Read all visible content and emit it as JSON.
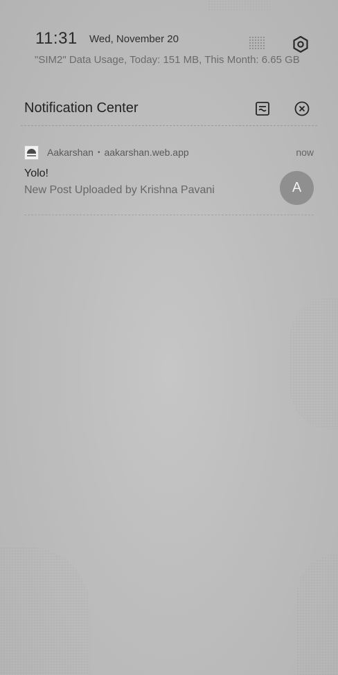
{
  "status": {
    "time": "11:31",
    "date": "Wed, November 20",
    "data_usage": "\"SIM2\" Data Usage, Today: 151 MB, This Month: 6.65 GB",
    "icons": [
      "dotted-grid-icon",
      "settings-gear-icon"
    ]
  },
  "notification_center": {
    "title": "Notification Center",
    "manage_icon": "manage-notifications-icon",
    "clear_icon": "clear-all-icon"
  },
  "notification": {
    "app_name": "Aakarshan",
    "source": "aakarshan.web.app",
    "separator": "•",
    "time": "now",
    "title": "Yolo!",
    "body": "New Post Uploaded by Krishna Pavani",
    "avatar_letter": "A"
  },
  "colors": {
    "background": "#bdbdbd",
    "avatar": "#8f8f8f",
    "text_primary": "#232323",
    "text_secondary": "#666666"
  }
}
